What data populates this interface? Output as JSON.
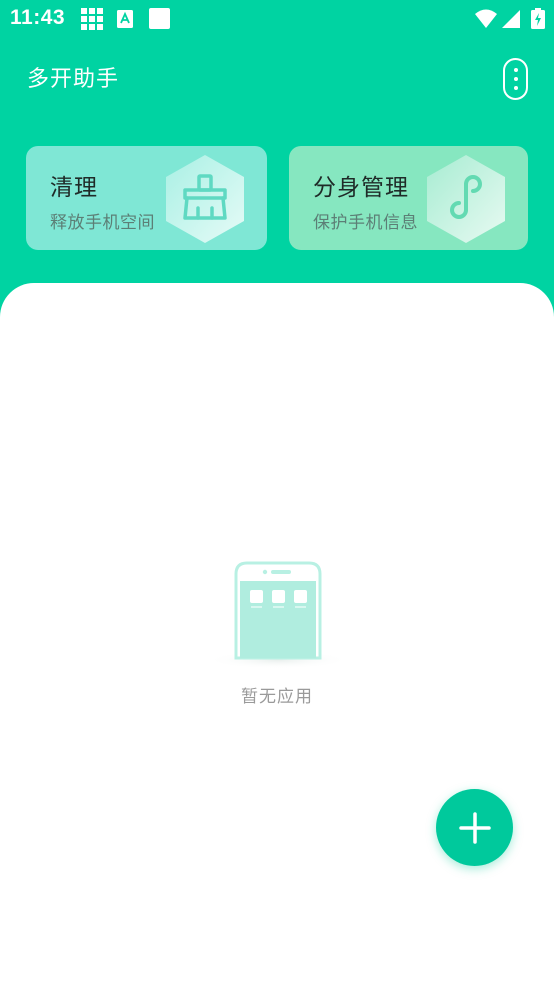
{
  "status_bar": {
    "time": "11:43",
    "icons": [
      "grid-icon",
      "a-notification-icon",
      "white-square-icon",
      "wifi-icon",
      "signal-icon",
      "battery-charging-icon"
    ]
  },
  "header": {
    "title": "多开助手",
    "menu_icon": "more-vertical-icon"
  },
  "cards": [
    {
      "title": "清理",
      "subtitle": "释放手机空间",
      "icon": "broom-icon",
      "color": "#7fe7d5"
    },
    {
      "title": "分身管理",
      "subtitle": "保护手机信息",
      "icon": "link-icon",
      "color": "#86e7c0"
    }
  ],
  "empty_state": {
    "text": "暂无应用",
    "illustration": "phone-empty-icon"
  },
  "fab": {
    "icon": "plus-icon"
  },
  "colors": {
    "accent": "#00d3a2",
    "fab": "#00c99c",
    "background": "#ffffff",
    "text_muted": "#9a9a9a"
  }
}
